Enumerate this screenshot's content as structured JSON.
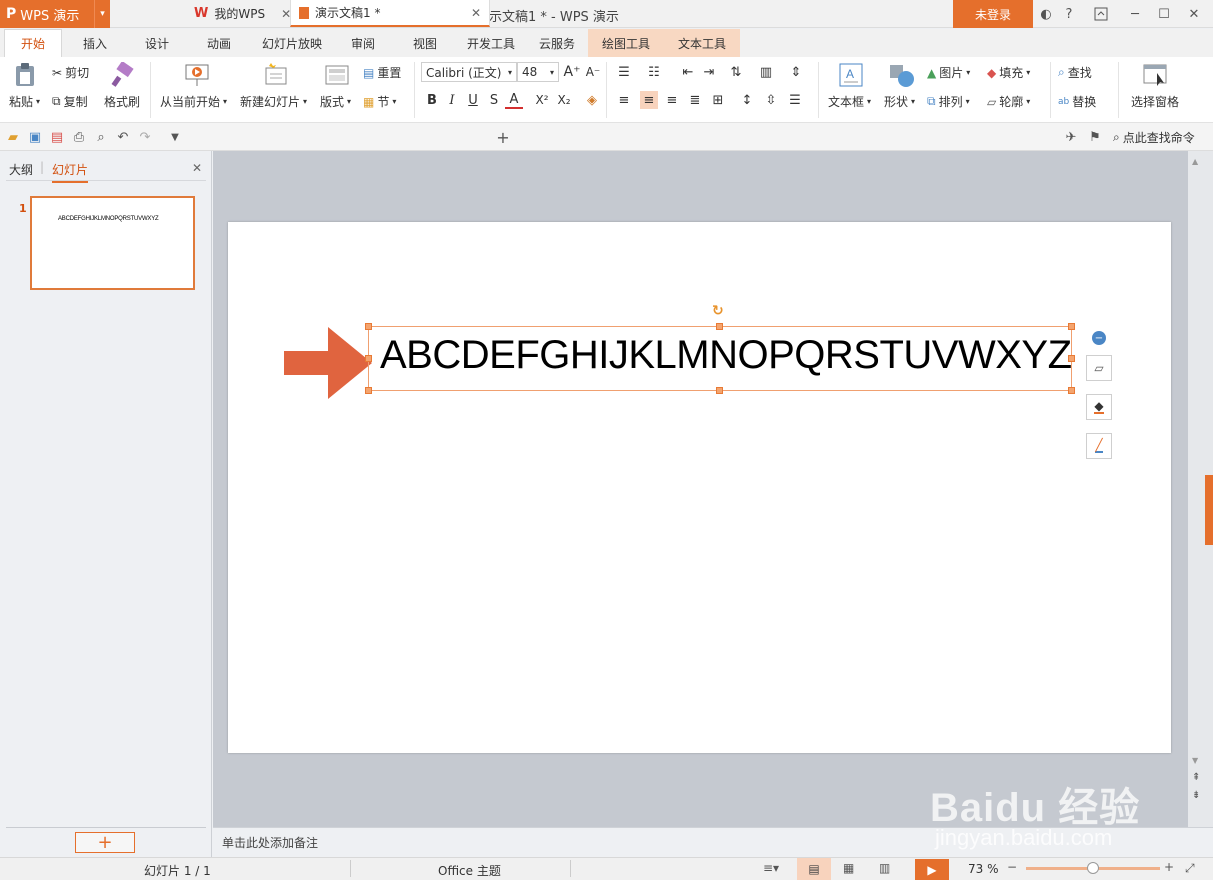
{
  "app": {
    "menu_label": "WPS 演示",
    "document_title": "演示文稿1 * - WPS 演示",
    "login_label": "未登录"
  },
  "tabs": [
    {
      "label": "开始"
    },
    {
      "label": "插入"
    },
    {
      "label": "设计"
    },
    {
      "label": "动画"
    },
    {
      "label": "幻灯片放映"
    },
    {
      "label": "审阅"
    },
    {
      "label": "视图"
    },
    {
      "label": "开发工具"
    },
    {
      "label": "云服务"
    },
    {
      "label": "绘图工具"
    },
    {
      "label": "文本工具"
    }
  ],
  "ribbon": {
    "paste": "粘贴",
    "cut": "剪切",
    "copy": "复制",
    "format_painter": "格式刷",
    "from_current": "从当前开始",
    "new_slide": "新建幻灯片",
    "layout": "版式",
    "reset": "重置",
    "section": "节",
    "font_name": "Calibri (正文)",
    "font_size": "48",
    "text_box": "文本框",
    "shapes": "形状",
    "picture": "图片",
    "arrange": "排列",
    "fill": "填充",
    "outline": "轮廓",
    "find": "查找",
    "replace": "替换",
    "selection_pane": "选择窗格"
  },
  "doc_tabs": [
    {
      "label": "我的WPS"
    },
    {
      "label": "演示文稿1 *"
    }
  ],
  "search_command": "点此查找命令",
  "panel": {
    "outline_tab": "大纲",
    "slides_tab": "幻灯片",
    "slide_number": "1",
    "thumb_text": "ABCDEFGHIJKLMNOPQRSTUVWXYZ"
  },
  "slide": {
    "text": "ABCDEFGHIJKLMNOPQRSTUVWXYZ"
  },
  "notes_placeholder": "单击此处添加备注",
  "status": {
    "slide_counter": "幻灯片 1 / 1",
    "theme": "Office 主题",
    "zoom": "73 %"
  },
  "zoom_level": 0.5,
  "colors": {
    "accent": "#e56f2c",
    "arrow": "#e0643f"
  },
  "watermark": {
    "logo": "Baidu 经验",
    "url": "jingyan.baidu.com"
  }
}
